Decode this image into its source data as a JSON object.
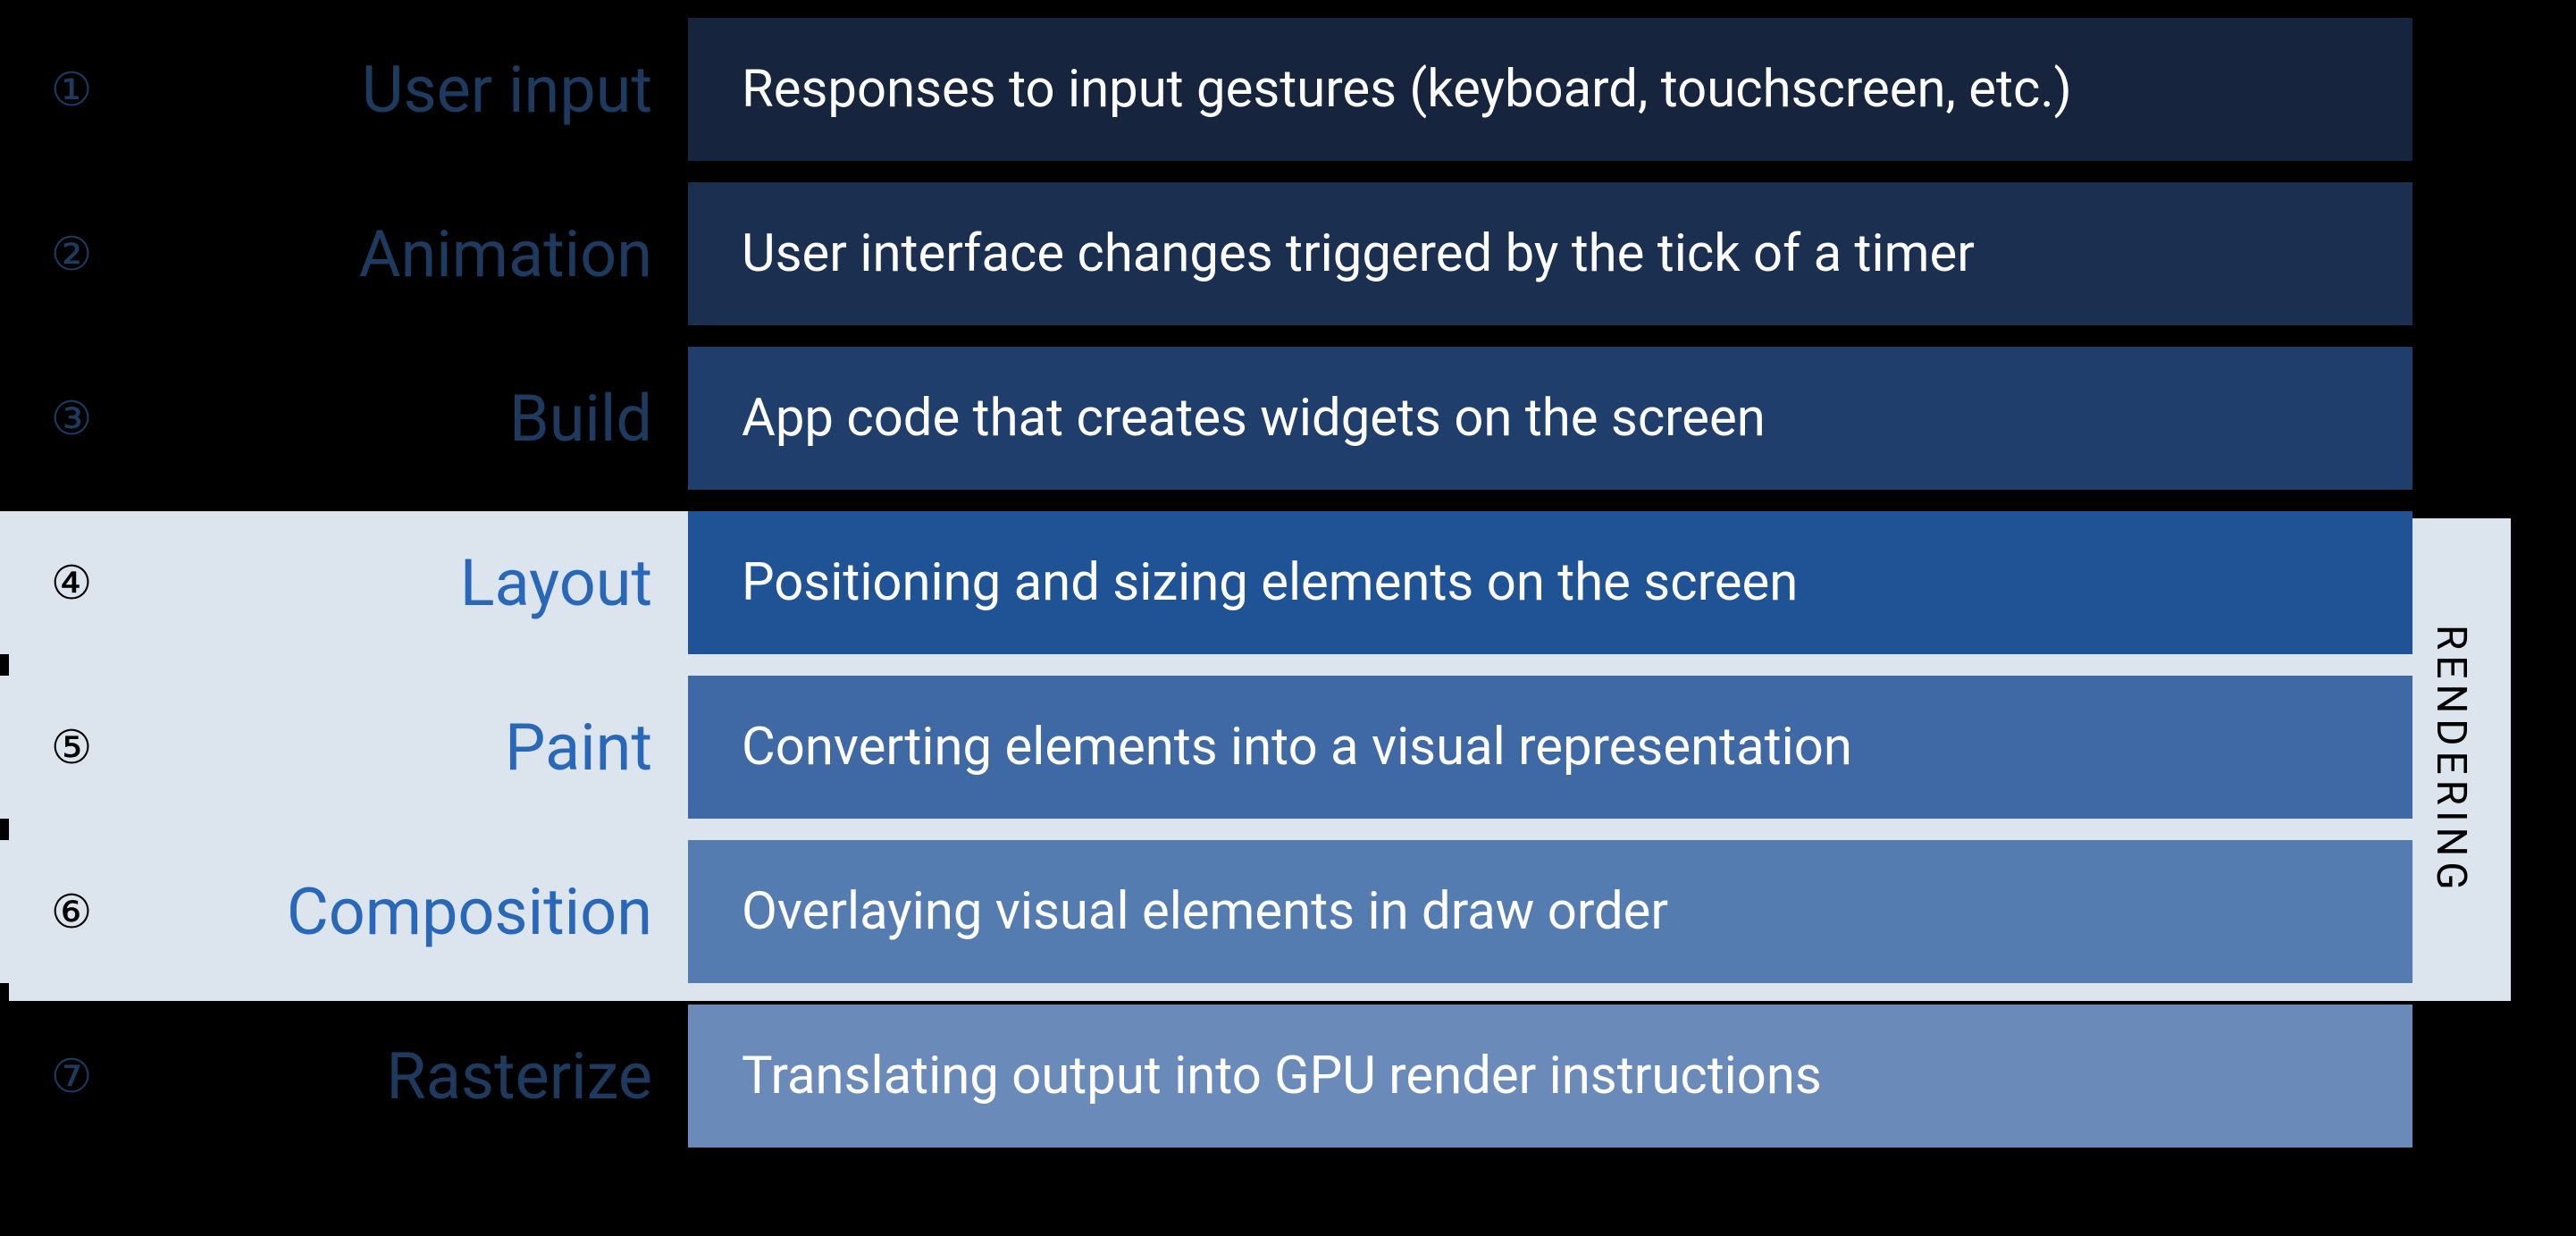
{
  "rows": [
    {
      "num": "①",
      "label": "User input",
      "description": "Responses to input gestures (keyboard, touchscreen, etc.)"
    },
    {
      "num": "②",
      "label": "Animation",
      "description": "User interface changes triggered by the tick of a timer"
    },
    {
      "num": "③",
      "label": "Build",
      "description": "App code that creates widgets on the screen"
    },
    {
      "num": "④",
      "label": "Layout",
      "description": "Positioning and sizing elements on the screen"
    },
    {
      "num": "⑤",
      "label": "Paint",
      "description": "Converting elements into a visual representation"
    },
    {
      "num": "⑥",
      "label": "Composition",
      "description": "Overlaying visual elements in draw order"
    },
    {
      "num": "⑦",
      "label": "Rasterize",
      "description": "Translating output into GPU render instructions"
    }
  ],
  "group_label": "RENDERING"
}
